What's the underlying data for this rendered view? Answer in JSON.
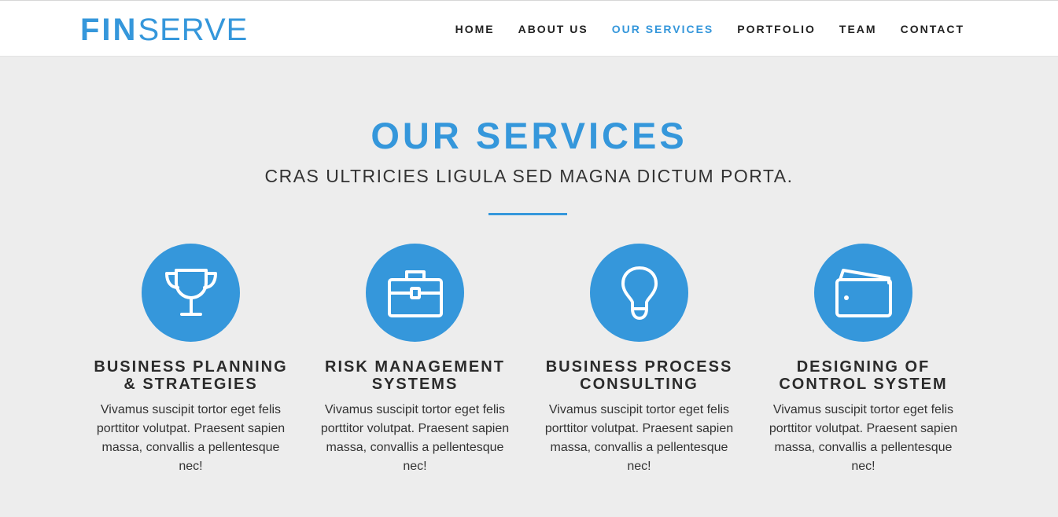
{
  "header": {
    "logo_bold": "FIN",
    "logo_light": "SERVE",
    "nav": [
      {
        "label": "HOME"
      },
      {
        "label": "ABOUT US"
      },
      {
        "label": "OUR SERVICES"
      },
      {
        "label": "PORTFOLIO"
      },
      {
        "label": "TEAM"
      },
      {
        "label": "CONTACT"
      }
    ],
    "active_nav": "OUR SERVICES"
  },
  "section": {
    "title": "OUR SERVICES",
    "subtitle": "CRAS ULTRICIES LIGULA SED MAGNA DICTUM PORTA."
  },
  "services": [
    {
      "icon": "trophy-icon",
      "title": "BUSINESS PLANNING & STRATEGIES",
      "text": "Vivamus suscipit tortor eget felis porttitor volutpat. Praesent sapien massa, convallis a pellentesque nec!"
    },
    {
      "icon": "briefcase-icon",
      "title": "RISK MANAGEMENT SYSTEMS",
      "text": "Vivamus suscipit tortor eget felis porttitor volutpat. Praesent sapien massa, convallis a pellentesque nec!"
    },
    {
      "icon": "lightbulb-icon",
      "title": "BUSINESS PROCESS CONSULTING",
      "text": "Vivamus suscipit tortor eget felis porttitor volutpat. Praesent sapien massa, convallis a pellentesque nec!"
    },
    {
      "icon": "wallet-icon",
      "title": "DESIGNING OF CONTROL SYSTEM",
      "text": "Vivamus suscipit tortor eget felis porttitor volutpat. Praesent sapien massa, convallis a pellentesque nec!"
    }
  ],
  "colors": {
    "accent": "#3597db",
    "background": "#ededed",
    "heading": "#2b2b2b"
  }
}
